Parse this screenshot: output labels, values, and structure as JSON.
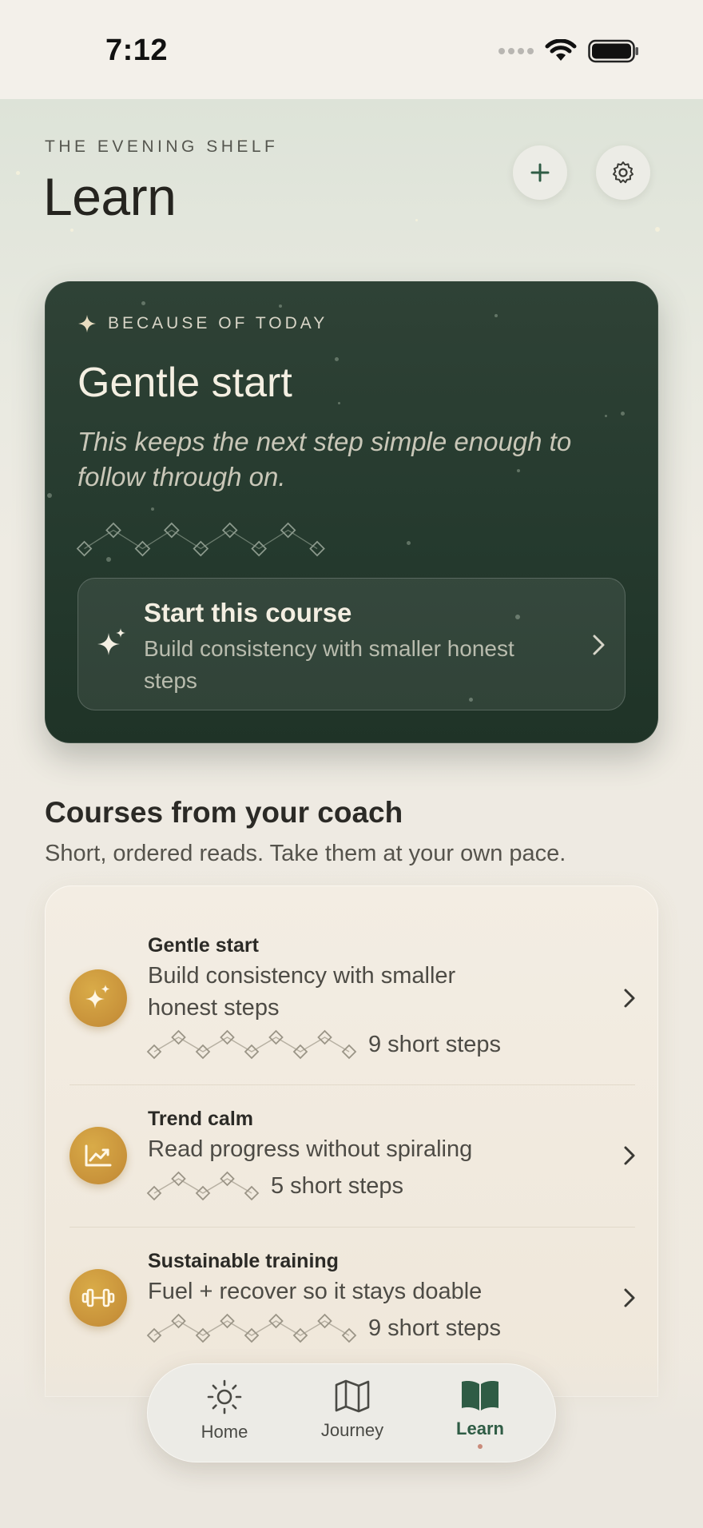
{
  "status_bar": {
    "time": "7:12"
  },
  "header": {
    "eyebrow": "THE EVENING SHELF",
    "title": "Learn",
    "add_icon": "plus-icon",
    "settings_icon": "gear-icon"
  },
  "hero": {
    "eyebrow": "BECAUSE OF TODAY",
    "title": "Gentle start",
    "body": "This keeps the next step simple enough to follow through on.",
    "steps_count": 9,
    "cta": {
      "title": "Start this course",
      "subtitle": "Build consistency with smaller honest steps",
      "icon": "sparkles-icon"
    },
    "colors": {
      "background": "#253a2e",
      "text": "#f4efe2"
    }
  },
  "courses": {
    "title": "Courses from your coach",
    "subtitle": "Short, ordered reads. Take them at your own pace.",
    "items": [
      {
        "name": "Gentle start",
        "description": "Build consistency with smaller honest steps",
        "steps": "9 short steps",
        "step_count": 9,
        "icon": "sparkles-icon"
      },
      {
        "name": "Trend calm",
        "description": "Read progress without spiraling",
        "steps": "5 short steps",
        "step_count": 5,
        "icon": "trend-chart-icon"
      },
      {
        "name": "Sustainable training",
        "description": "Fuel + recover so it stays doable",
        "steps": "9 short steps",
        "step_count": 9,
        "icon": "dumbbell-icon"
      }
    ],
    "accent": "#c8923a"
  },
  "tabbar": {
    "tabs": [
      {
        "label": "Home",
        "icon": "sun-icon"
      },
      {
        "label": "Journey",
        "icon": "map-icon"
      },
      {
        "label": "Learn",
        "icon": "book-icon",
        "active": true
      }
    ]
  }
}
